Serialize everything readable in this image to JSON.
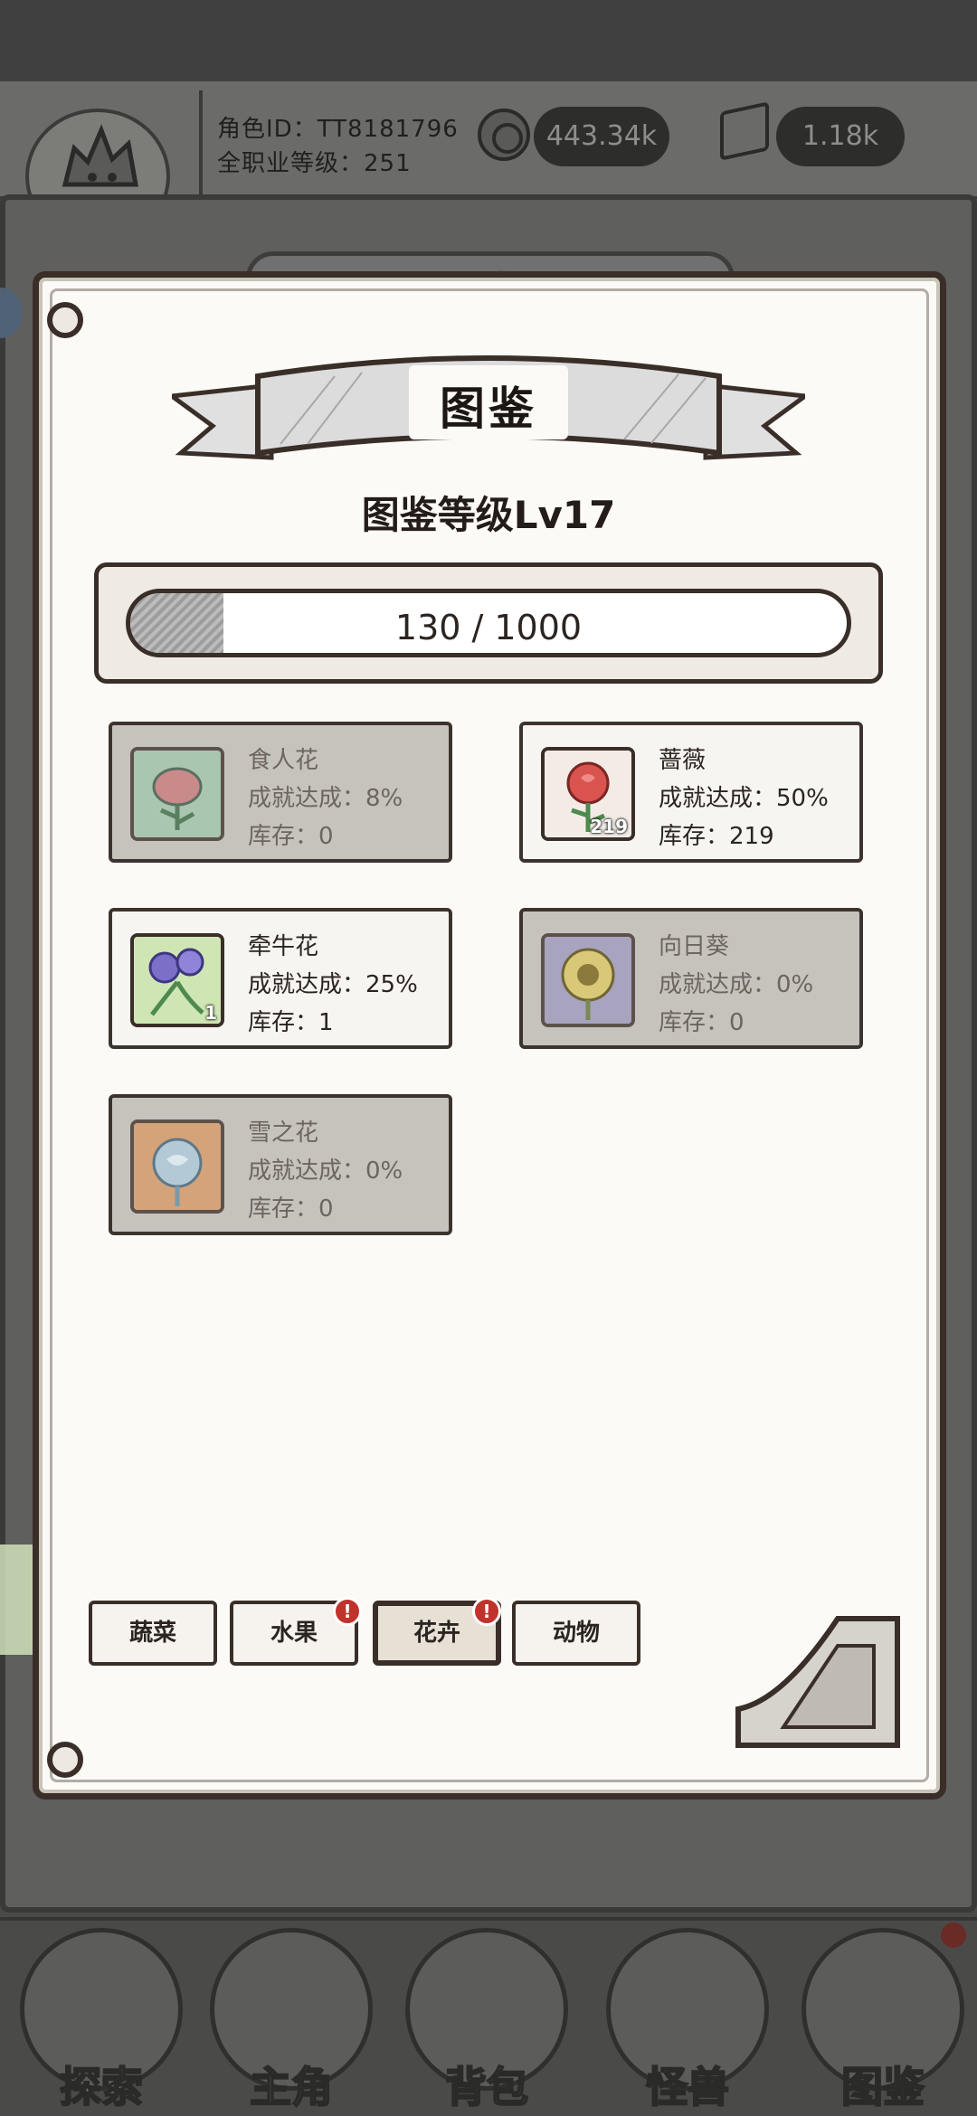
{
  "hud": {
    "role_id": "角色ID：TT8181796",
    "total_level": "全职业等级：251",
    "coins": "443.34k",
    "gems": "1.18k"
  },
  "board_tab_title": "图鉴",
  "collection": {
    "title": "图鉴",
    "level_text": "图鉴等级Lv17",
    "progress_text": "130 / 1000",
    "progress_fraction": 0.13
  },
  "items": [
    {
      "name": "食人花",
      "achievement": "成就达成：8%",
      "stock": "库存：0",
      "count": "",
      "locked": true,
      "color": "#8fb59a",
      "icon": "piranha-flower-icon"
    },
    {
      "name": "蔷薇",
      "achievement": "成就达成：50%",
      "stock": "库存：219",
      "count": "219",
      "locked": false,
      "color": "#d9534f",
      "icon": "rose-icon"
    },
    {
      "name": "牵牛花",
      "achievement": "成就达成：25%",
      "stock": "库存：1",
      "count": "1",
      "locked": false,
      "color": "#7b6fc8",
      "icon": "morning-glory-icon"
    },
    {
      "name": "向日葵",
      "achievement": "成就达成：0%",
      "stock": "库存：0",
      "count": "",
      "locked": true,
      "color": "#c9b45a",
      "icon": "sunflower-icon"
    },
    {
      "name": "雪之花",
      "achievement": "成就达成：0%",
      "stock": "库存：0",
      "count": "",
      "locked": true,
      "color": "#9fb8c8",
      "icon": "snow-flower-icon"
    }
  ],
  "tabs": [
    {
      "label": "蔬菜",
      "badge": false
    },
    {
      "label": "水果",
      "badge": true
    },
    {
      "label": "花卉",
      "badge": true,
      "active": true
    },
    {
      "label": "动物",
      "badge": false
    }
  ],
  "badge_mark": "!",
  "nav": [
    {
      "label": "探索",
      "icon": "explore-icon"
    },
    {
      "label": "主角",
      "icon": "hero-icon"
    },
    {
      "label": "背包",
      "icon": "backpack-icon"
    },
    {
      "label": "怪兽",
      "icon": "monster-icon"
    },
    {
      "label": "图鉴",
      "icon": "collection-book-icon"
    }
  ]
}
